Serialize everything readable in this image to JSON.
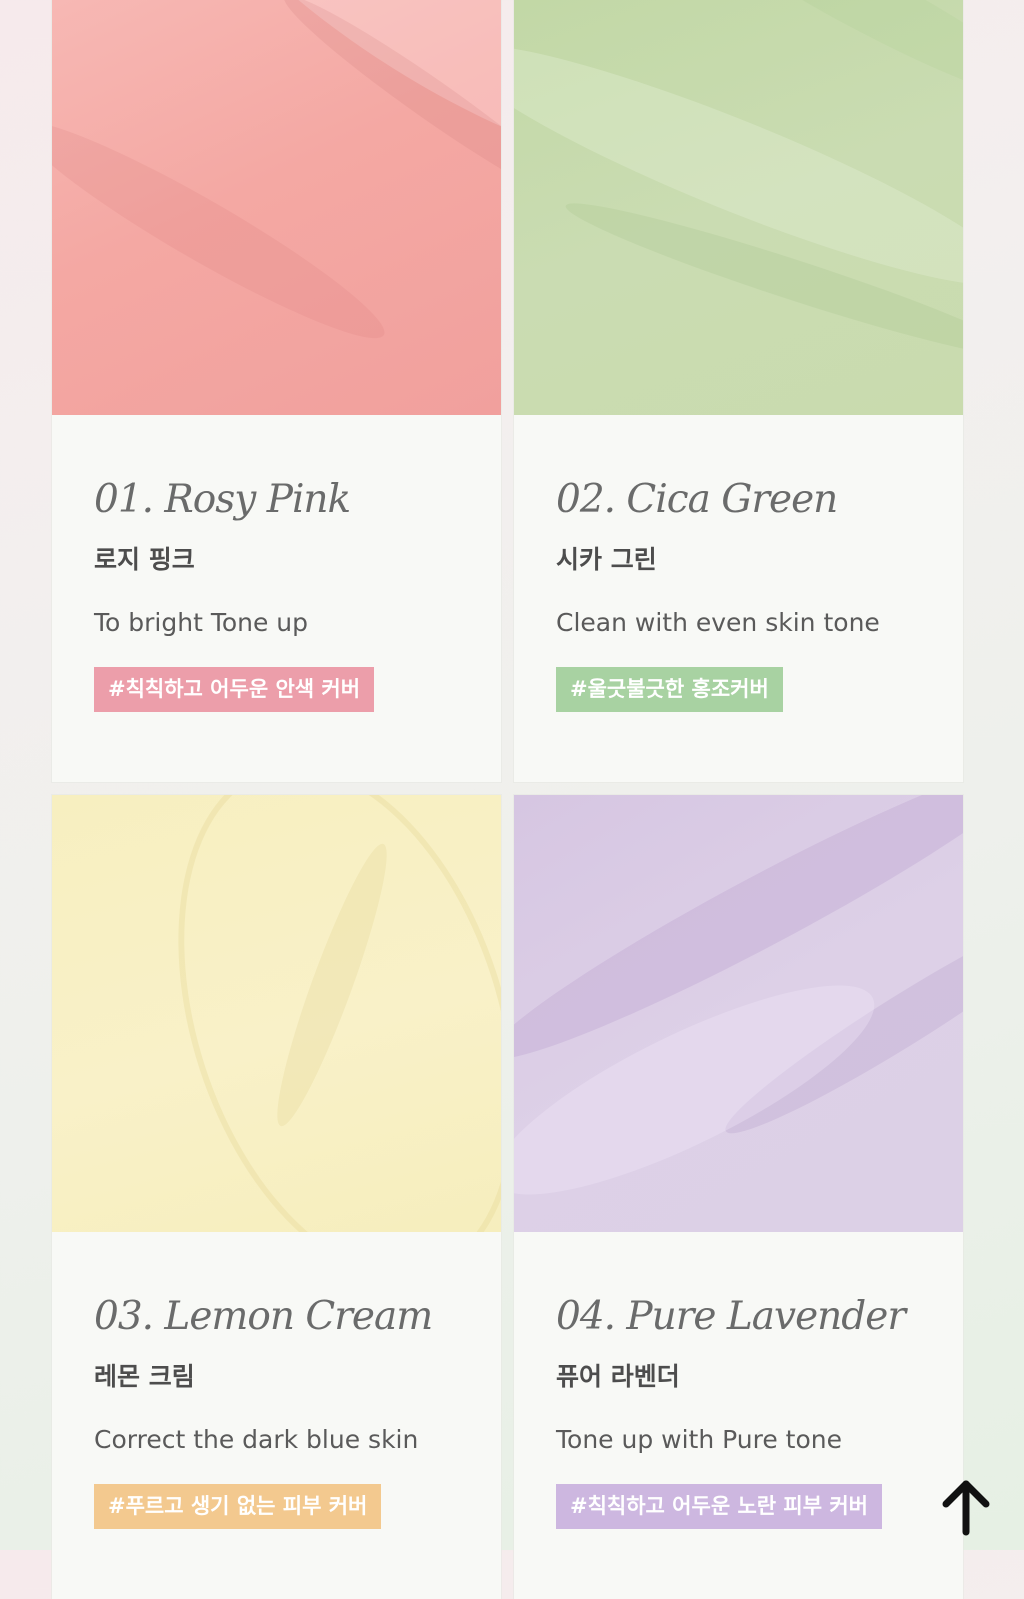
{
  "products": [
    {
      "title": "01. Rosy Pink",
      "ko_name": "로지 핑크",
      "description": "To bright Tone up",
      "tag": "#칙칙하고 어두운 안색 커버",
      "swatch_color": "#f4aaa5",
      "tag_color": "#ec9eaa"
    },
    {
      "title": "02. Cica Green",
      "ko_name": "시카 그린",
      "description": "Clean with even skin tone",
      "tag": "#울긋불긋한 홍조커버",
      "swatch_color": "#c9dbb0",
      "tag_color": "#a8d2a2"
    },
    {
      "title": "03. Lemon Cream",
      "ko_name": "레몬 크림",
      "description": "Correct the dark blue skin",
      "tag": "#푸르고 생기 없는 피부 커버",
      "swatch_color": "#f8f0c2",
      "tag_color": "#f3c98f"
    },
    {
      "title": "04. Pure Lavender",
      "ko_name": "퓨어 라벤더",
      "description": "Tone up with Pure tone",
      "tag": "#칙칙하고 어두운 노란 피부 커버",
      "swatch_color": "#dccfe6",
      "tag_color": "#cdb7e0"
    }
  ],
  "scroll_top_icon": "arrow-up-icon"
}
